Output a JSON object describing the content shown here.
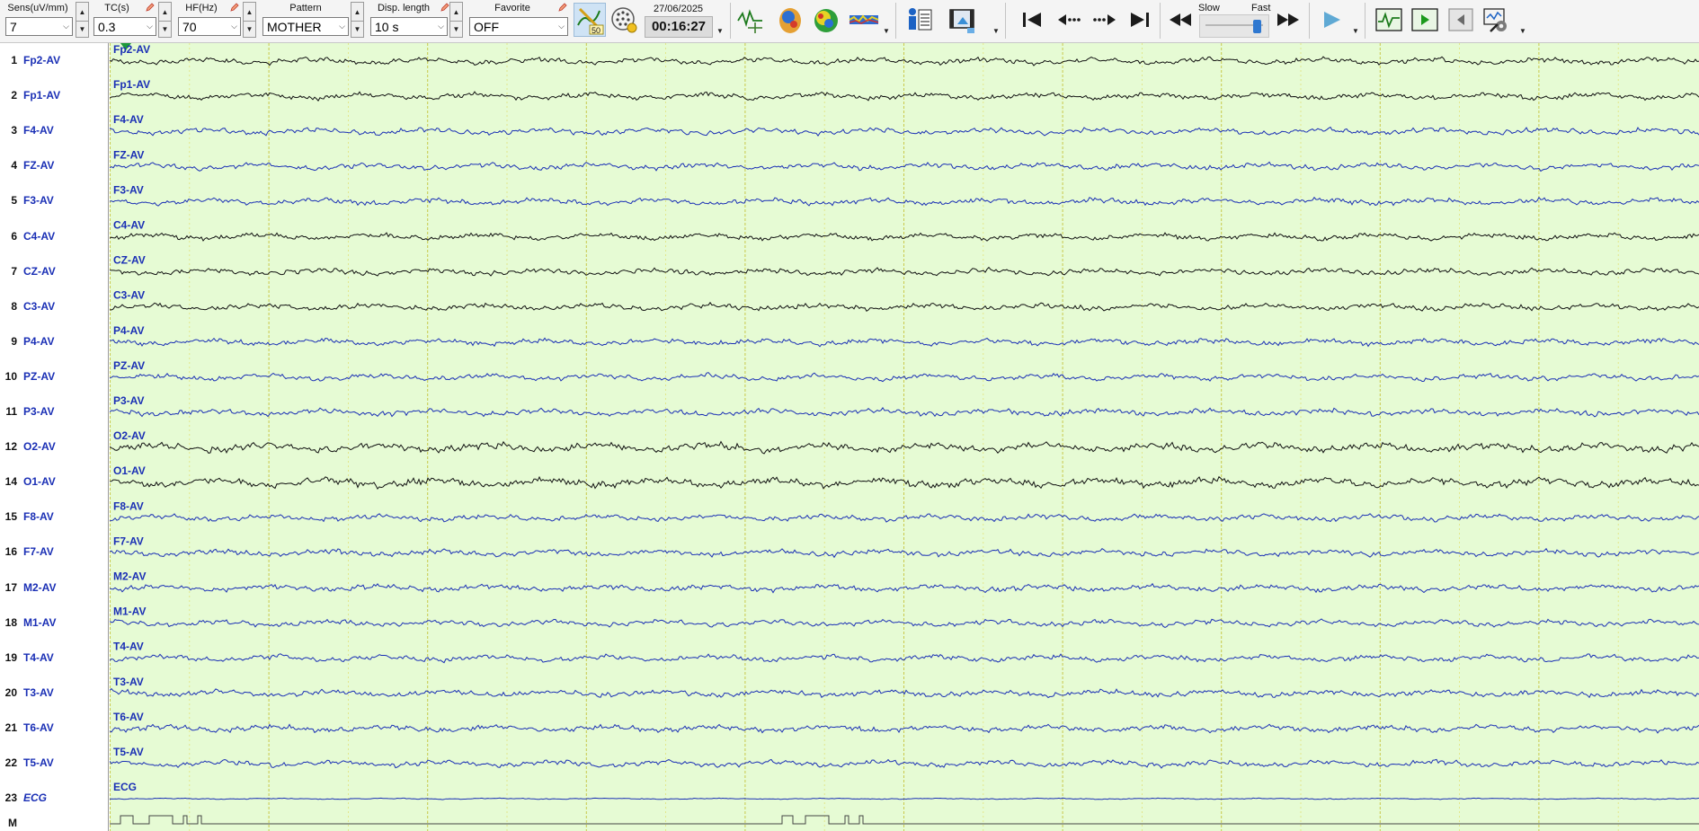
{
  "toolbar": {
    "sensitivity": {
      "label": "Sens(uV/mm)",
      "value": "7"
    },
    "time_constant": {
      "label": "TC(s)",
      "value": "0.3"
    },
    "high_filter": {
      "label": "HF(Hz)",
      "value": "70"
    },
    "pattern": {
      "label": "Pattern",
      "value": "MOTHER"
    },
    "display_length": {
      "label": "Disp. length",
      "value": "10 s"
    },
    "favorite": {
      "label": "Favorite",
      "value": "OFF"
    },
    "notch_badge": "50",
    "date": "27/06/2025",
    "time": "00:16:27",
    "speed": {
      "slow_label": "Slow",
      "fast_label": "Fast",
      "level": 0.85
    }
  },
  "channels": [
    {
      "number": "1",
      "name": "Fp2-AV",
      "color": "#1a2fb5"
    },
    {
      "number": "2",
      "name": "Fp1-AV",
      "color": "#1a2fb5"
    },
    {
      "number": "3",
      "name": "F4-AV",
      "color": "#1a2fb5"
    },
    {
      "number": "4",
      "name": "FZ-AV",
      "color": "#1a2fb5"
    },
    {
      "number": "5",
      "name": "F3-AV",
      "color": "#1a2fb5"
    },
    {
      "number": "6",
      "name": "C4-AV",
      "color": "#1a2fb5"
    },
    {
      "number": "7",
      "name": "CZ-AV",
      "color": "#1a2fb5"
    },
    {
      "number": "8",
      "name": "C3-AV",
      "color": "#1a2fb5"
    },
    {
      "number": "9",
      "name": "P4-AV",
      "color": "#1a2fb5"
    },
    {
      "number": "10",
      "name": "PZ-AV",
      "color": "#1a2fb5"
    },
    {
      "number": "11",
      "name": "P3-AV",
      "color": "#1a2fb5"
    },
    {
      "number": "12",
      "name": "O2-AV",
      "color": "#1a2fb5"
    },
    {
      "number": "14",
      "name": "O1-AV",
      "color": "#1a2fb5"
    },
    {
      "number": "15",
      "name": "F8-AV",
      "color": "#1a2fb5"
    },
    {
      "number": "16",
      "name": "F7-AV",
      "color": "#1a2fb5"
    },
    {
      "number": "17",
      "name": "M2-AV",
      "color": "#1a2fb5"
    },
    {
      "number": "18",
      "name": "M1-AV",
      "color": "#1a2fb5"
    },
    {
      "number": "19",
      "name": "T4-AV",
      "color": "#1a2fb5"
    },
    {
      "number": "20",
      "name": "T3-AV",
      "color": "#1a2fb5"
    },
    {
      "number": "21",
      "name": "T6-AV",
      "color": "#1a2fb5"
    },
    {
      "number": "22",
      "name": "T5-AV",
      "color": "#1a2fb5"
    },
    {
      "number": "23",
      "name": "ECG",
      "color": "#1a2fb5",
      "italic": true
    },
    {
      "number": "M",
      "name": "",
      "color": "#111111"
    }
  ],
  "traces": [
    {
      "label": "Fp2-AV",
      "color": "#111111"
    },
    {
      "label": "Fp1-AV",
      "color": "#111111"
    },
    {
      "label": "F4-AV",
      "color": "#1a2fb5"
    },
    {
      "label": "FZ-AV",
      "color": "#1a2fb5"
    },
    {
      "label": "F3-AV",
      "color": "#1a2fb5"
    },
    {
      "label": "C4-AV",
      "color": "#111111"
    },
    {
      "label": "CZ-AV",
      "color": "#111111"
    },
    {
      "label": "C3-AV",
      "color": "#111111"
    },
    {
      "label": "P4-AV",
      "color": "#1a2fb5"
    },
    {
      "label": "PZ-AV",
      "color": "#1a2fb5"
    },
    {
      "label": "P3-AV",
      "color": "#1a2fb5"
    },
    {
      "label": "O2-AV",
      "color": "#111111"
    },
    {
      "label": "O1-AV",
      "color": "#111111"
    },
    {
      "label": "F8-AV",
      "color": "#1a2fb5"
    },
    {
      "label": "F7-AV",
      "color": "#1a2fb5"
    },
    {
      "label": "M2-AV",
      "color": "#1a2fb5"
    },
    {
      "label": "M1-AV",
      "color": "#1a2fb5"
    },
    {
      "label": "T4-AV",
      "color": "#1a2fb5"
    },
    {
      "label": "T3-AV",
      "color": "#1a2fb5"
    },
    {
      "label": "T6-AV",
      "color": "#1a2fb5"
    },
    {
      "label": "T5-AV",
      "color": "#1a2fb5"
    },
    {
      "label": "ECG",
      "color": "#1a2fb5"
    }
  ],
  "plot": {
    "background": "#e6fbd4",
    "second_grid_color": "#c9c94a",
    "half_grid_color": "#e2e27a"
  },
  "icons": [
    "montage-icon",
    "head-map-icon",
    "topomap-icon",
    "spectrum-icon",
    "patient-info-icon",
    "video-icon",
    "first-page-icon",
    "prev-page-icon",
    "next-page-icon",
    "last-page-icon",
    "rewind-icon",
    "fast-forward-icon",
    "play-icon",
    "signal-view-icon",
    "play-view-icon",
    "back-view-icon",
    "settings-tools-icon"
  ]
}
